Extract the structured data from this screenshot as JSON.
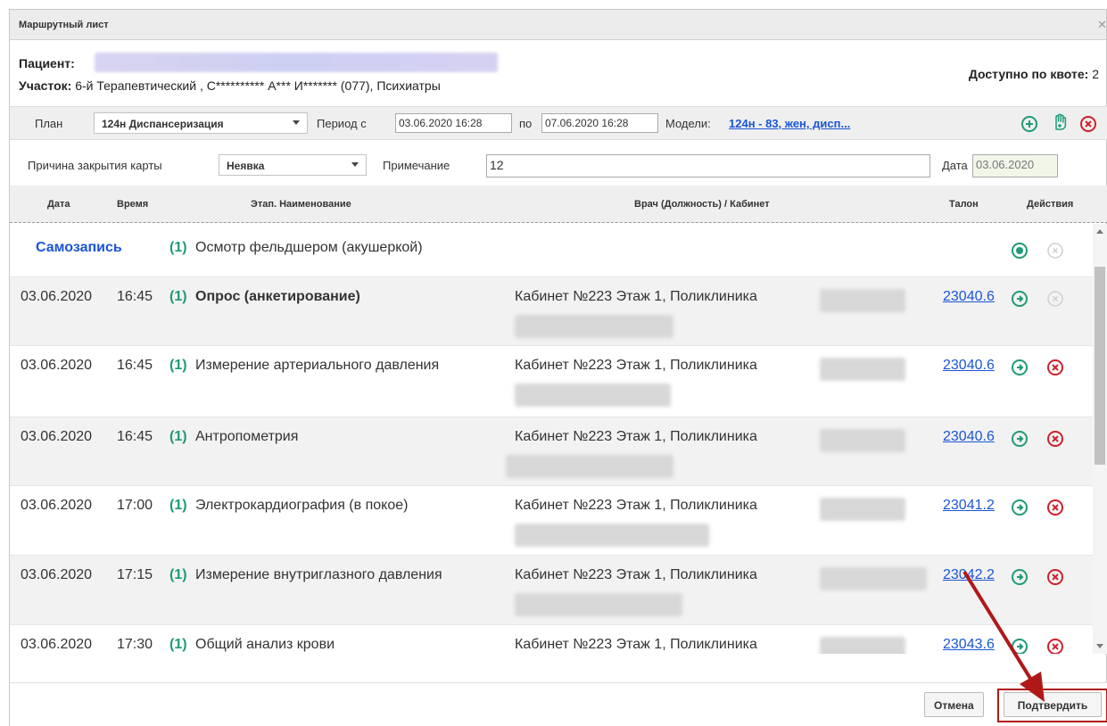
{
  "dialog": {
    "title": "Маршрутный лист",
    "close_icon": "close-icon"
  },
  "patient": {
    "label": "Пациент:",
    "site_label": "Участок:",
    "site_value": " 6-й Терапевтический , С********** А*** И******* (077), Психиатры",
    "quota_label": "Доступно по квоте:",
    "quota_value": " 2"
  },
  "plan": {
    "label": "План",
    "value": "124н Диспансеризация",
    "period_label": "Период с",
    "period_from": "03.06.2020 16:28",
    "period_to_label": "по",
    "period_to": "07.06.2020 16:28",
    "models_label": "Модели:",
    "models_link": "124н - 83, жен, дисп..."
  },
  "reason": {
    "label": "Причина закрытия карты",
    "value": "Неявка",
    "note_label": "Примечание",
    "note_value": "12",
    "date_label": "Дата",
    "date_value": "03.06.2020"
  },
  "table": {
    "headers": {
      "date": "Дата",
      "time": "Время",
      "stage": "Этап. Наименование",
      "doctor": "Врач (Должность) / Кабинет",
      "ticket": "Талон",
      "actions": "Действия"
    },
    "selfrecord": {
      "label": "Самозапись",
      "num": "(1)",
      "name": "Осмотр фельдшером (акушеркой)"
    },
    "rows": [
      {
        "date": "03.06.2020",
        "time": "16:45",
        "num": "(1)",
        "name": "Опрос (анкетирование)",
        "cabinet": "Кабинет №223 Этаж 1, Поликлиника",
        "ticket": "23040.6"
      },
      {
        "date": "03.06.2020",
        "time": "16:45",
        "num": "(1)",
        "name": "Измерение артериального давления",
        "cabinet": "Кабинет №223 Этаж 1, Поликлиника",
        "ticket": "23040.6"
      },
      {
        "date": "03.06.2020",
        "time": "16:45",
        "num": "(1)",
        "name": "Антропометрия",
        "cabinet": "Кабинет №223 Этаж 1, Поликлиника",
        "ticket": "23040.6"
      },
      {
        "date": "03.06.2020",
        "time": "17:00",
        "num": "(1)",
        "name": "Электрокардиография (в покое)",
        "cabinet": "Кабинет №223 Этаж 1, Поликлиника",
        "ticket": "23041.2"
      },
      {
        "date": "03.06.2020",
        "time": "17:15",
        "num": "(1)",
        "name": "Измерение внутриглазного давления",
        "cabinet": "Кабинет №223 Этаж 1, Поликлиника",
        "ticket": "23042.2"
      },
      {
        "date": "03.06.2020",
        "time": "17:30",
        "num": "(1)",
        "name": "Общий анализ крови",
        "cabinet": "Кабинет №223 Этаж 1, Поликлиника",
        "ticket": "23043.6"
      }
    ]
  },
  "footer": {
    "cancel_label": "Отмена",
    "confirm_label": "Подтвердить"
  },
  "colors": {
    "green": "#1f9a78",
    "red": "#d0202a",
    "link": "#1a55d6",
    "highlight": "#b01818"
  }
}
